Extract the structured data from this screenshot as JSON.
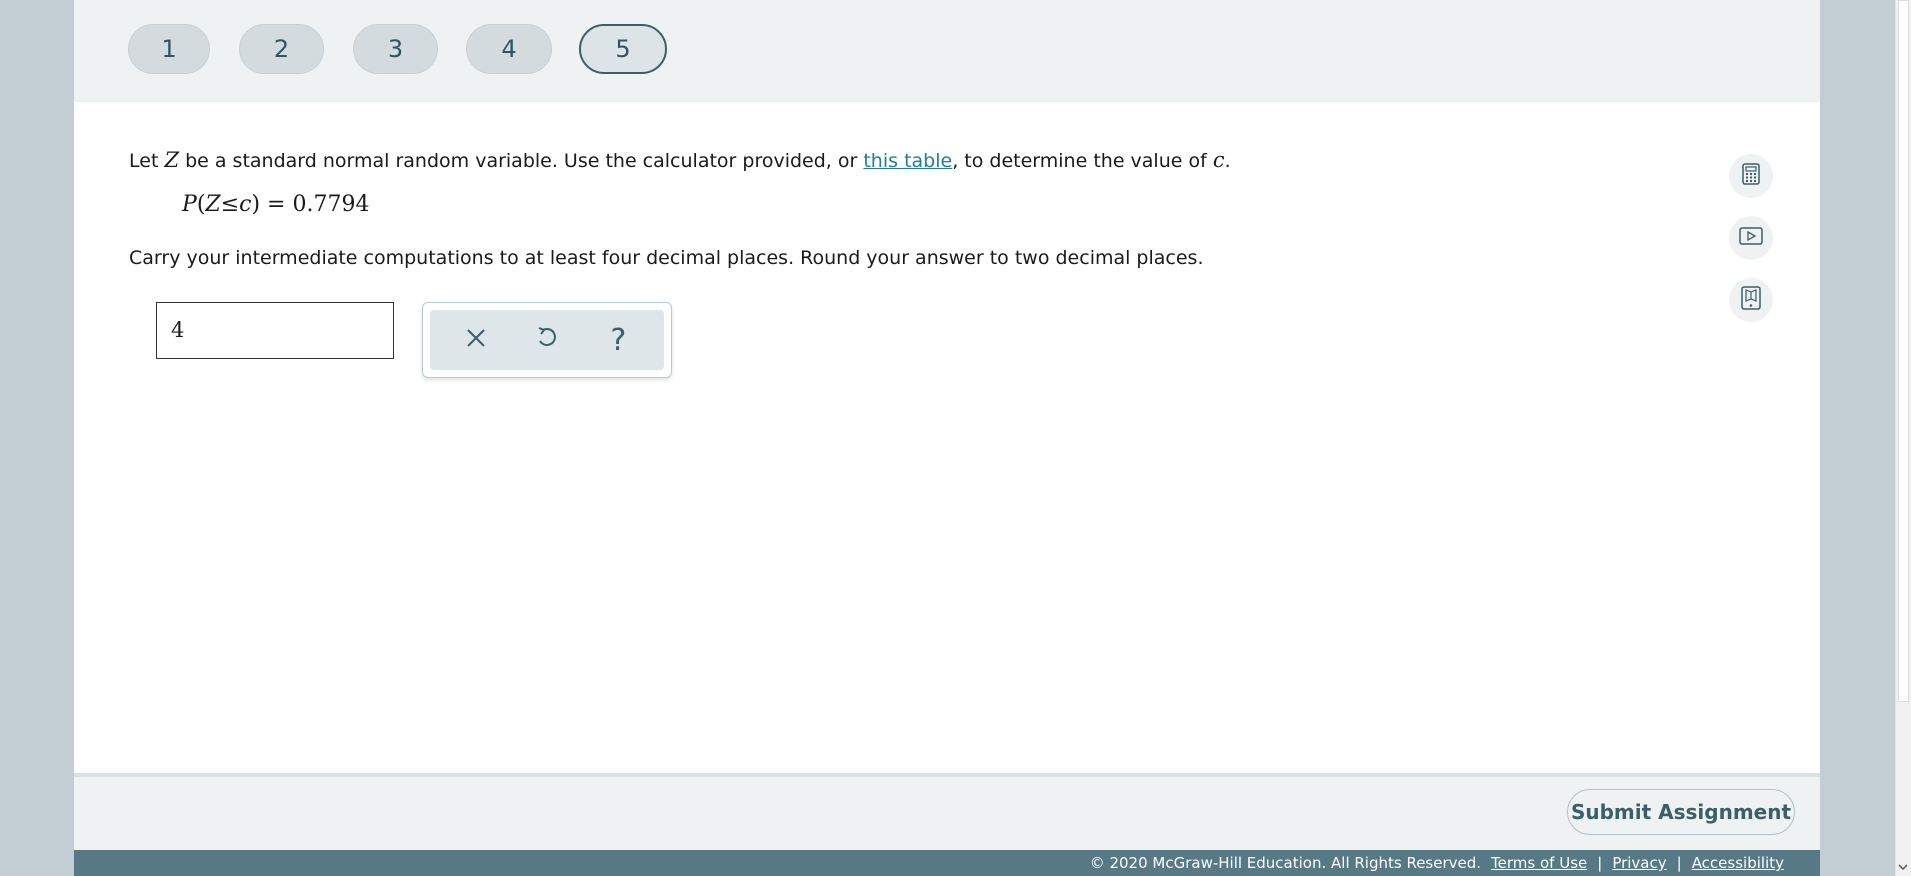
{
  "nav": {
    "questions": [
      "1",
      "2",
      "3",
      "4",
      "5"
    ],
    "active_question": "5"
  },
  "question": {
    "prefix": "Let ",
    "var_z": "Z",
    "mid": " be a standard normal random variable. Use the calculator provided, or ",
    "link_text": "this table",
    "suffix": ", to determine the value of ",
    "var_c": "c",
    "end": ".",
    "equation": {
      "p": "P",
      "open": "(",
      "z": "Z",
      "leq": "≤",
      "c": "c",
      "close": ")",
      "rhs": " = 0.7794"
    },
    "instructions": "Carry your intermediate computations to at least four decimal places. Round your answer to two decimal places."
  },
  "answer": {
    "value": "4"
  },
  "tools": {
    "clear_icon": "close-icon",
    "undo_icon": "undo-icon",
    "help_icon": "help-icon",
    "clear_glyph": "✕",
    "help_glyph": "?"
  },
  "side_tools": [
    "calculator-icon",
    "video-icon",
    "ebook-icon"
  ],
  "footer": {
    "submit_label": "Submit Assignment",
    "copyright": "© 2020 McGraw-Hill Education. All Rights Reserved.",
    "links": [
      "Terms of Use",
      "Privacy",
      "Accessibility"
    ],
    "separator": "|"
  },
  "colors": {
    "accent": "#3b5e68",
    "link": "#1e7f96",
    "footer_band": "#577985",
    "nav_bg": "#eef2f3"
  }
}
